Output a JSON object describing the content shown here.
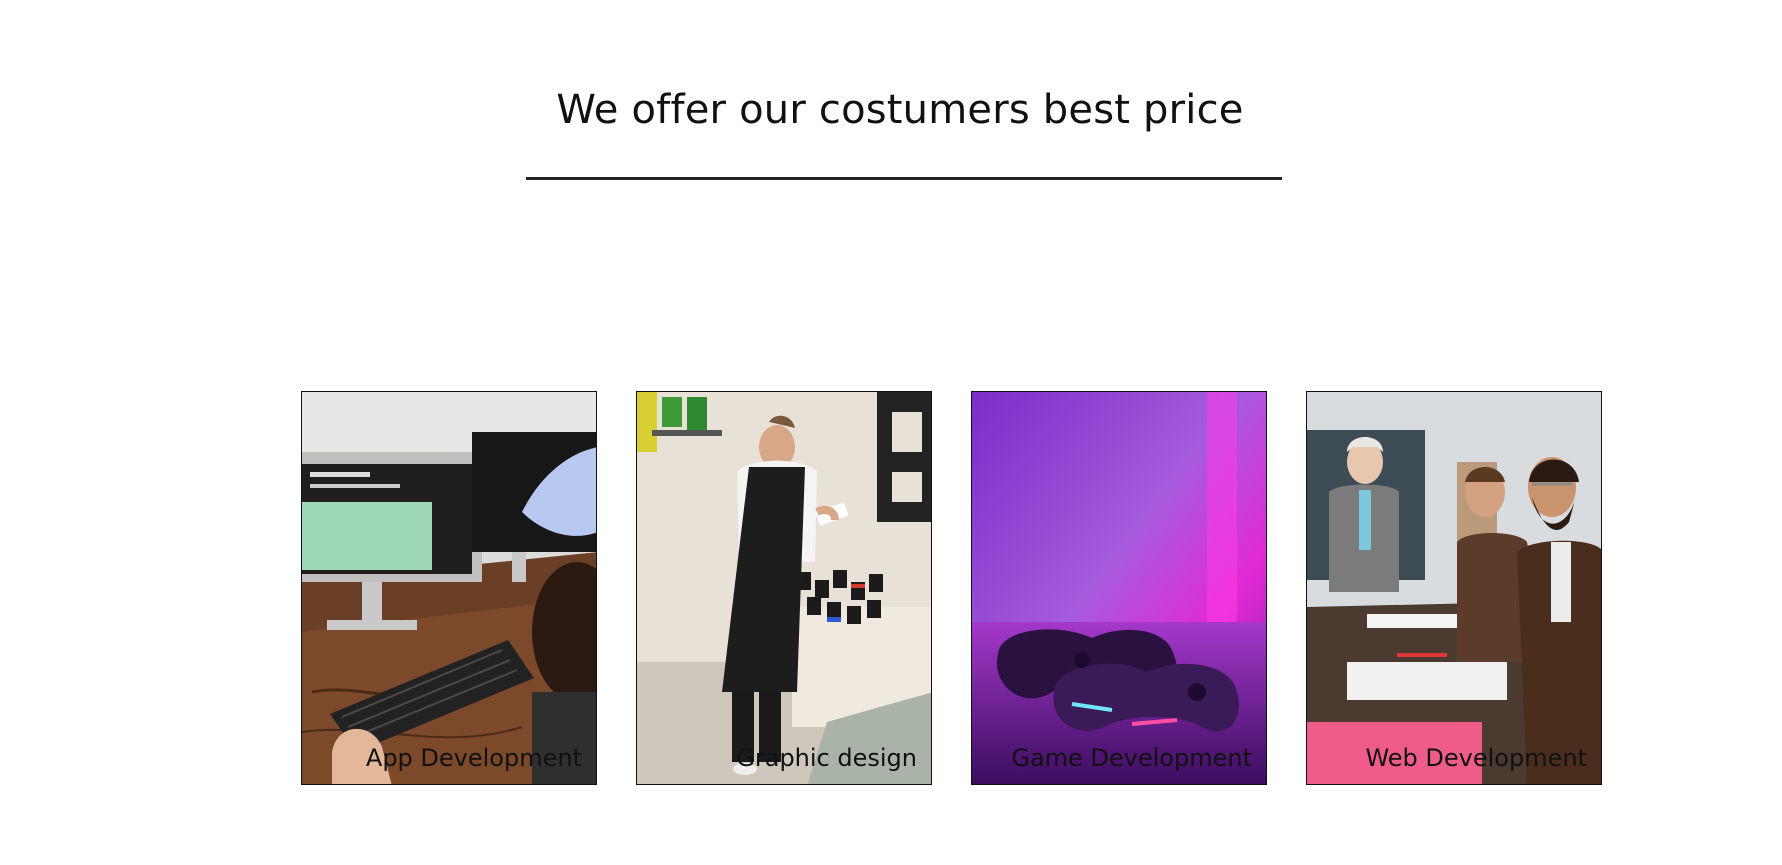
{
  "section": {
    "title": "We offer our costumers best price"
  },
  "services": [
    {
      "label": "App Development",
      "photo_icon": "desk-computer-photo"
    },
    {
      "label": "Graphic design",
      "photo_icon": "paint-workshop-photo"
    },
    {
      "label": "Game Development",
      "photo_icon": "game-controllers-photo"
    },
    {
      "label": "Web Development",
      "photo_icon": "meeting-team-photo"
    }
  ],
  "colors": {
    "text": "#111111",
    "border": "#111111",
    "game_magenta": "#c81ad8",
    "web_pink": "#ef5c8a"
  }
}
